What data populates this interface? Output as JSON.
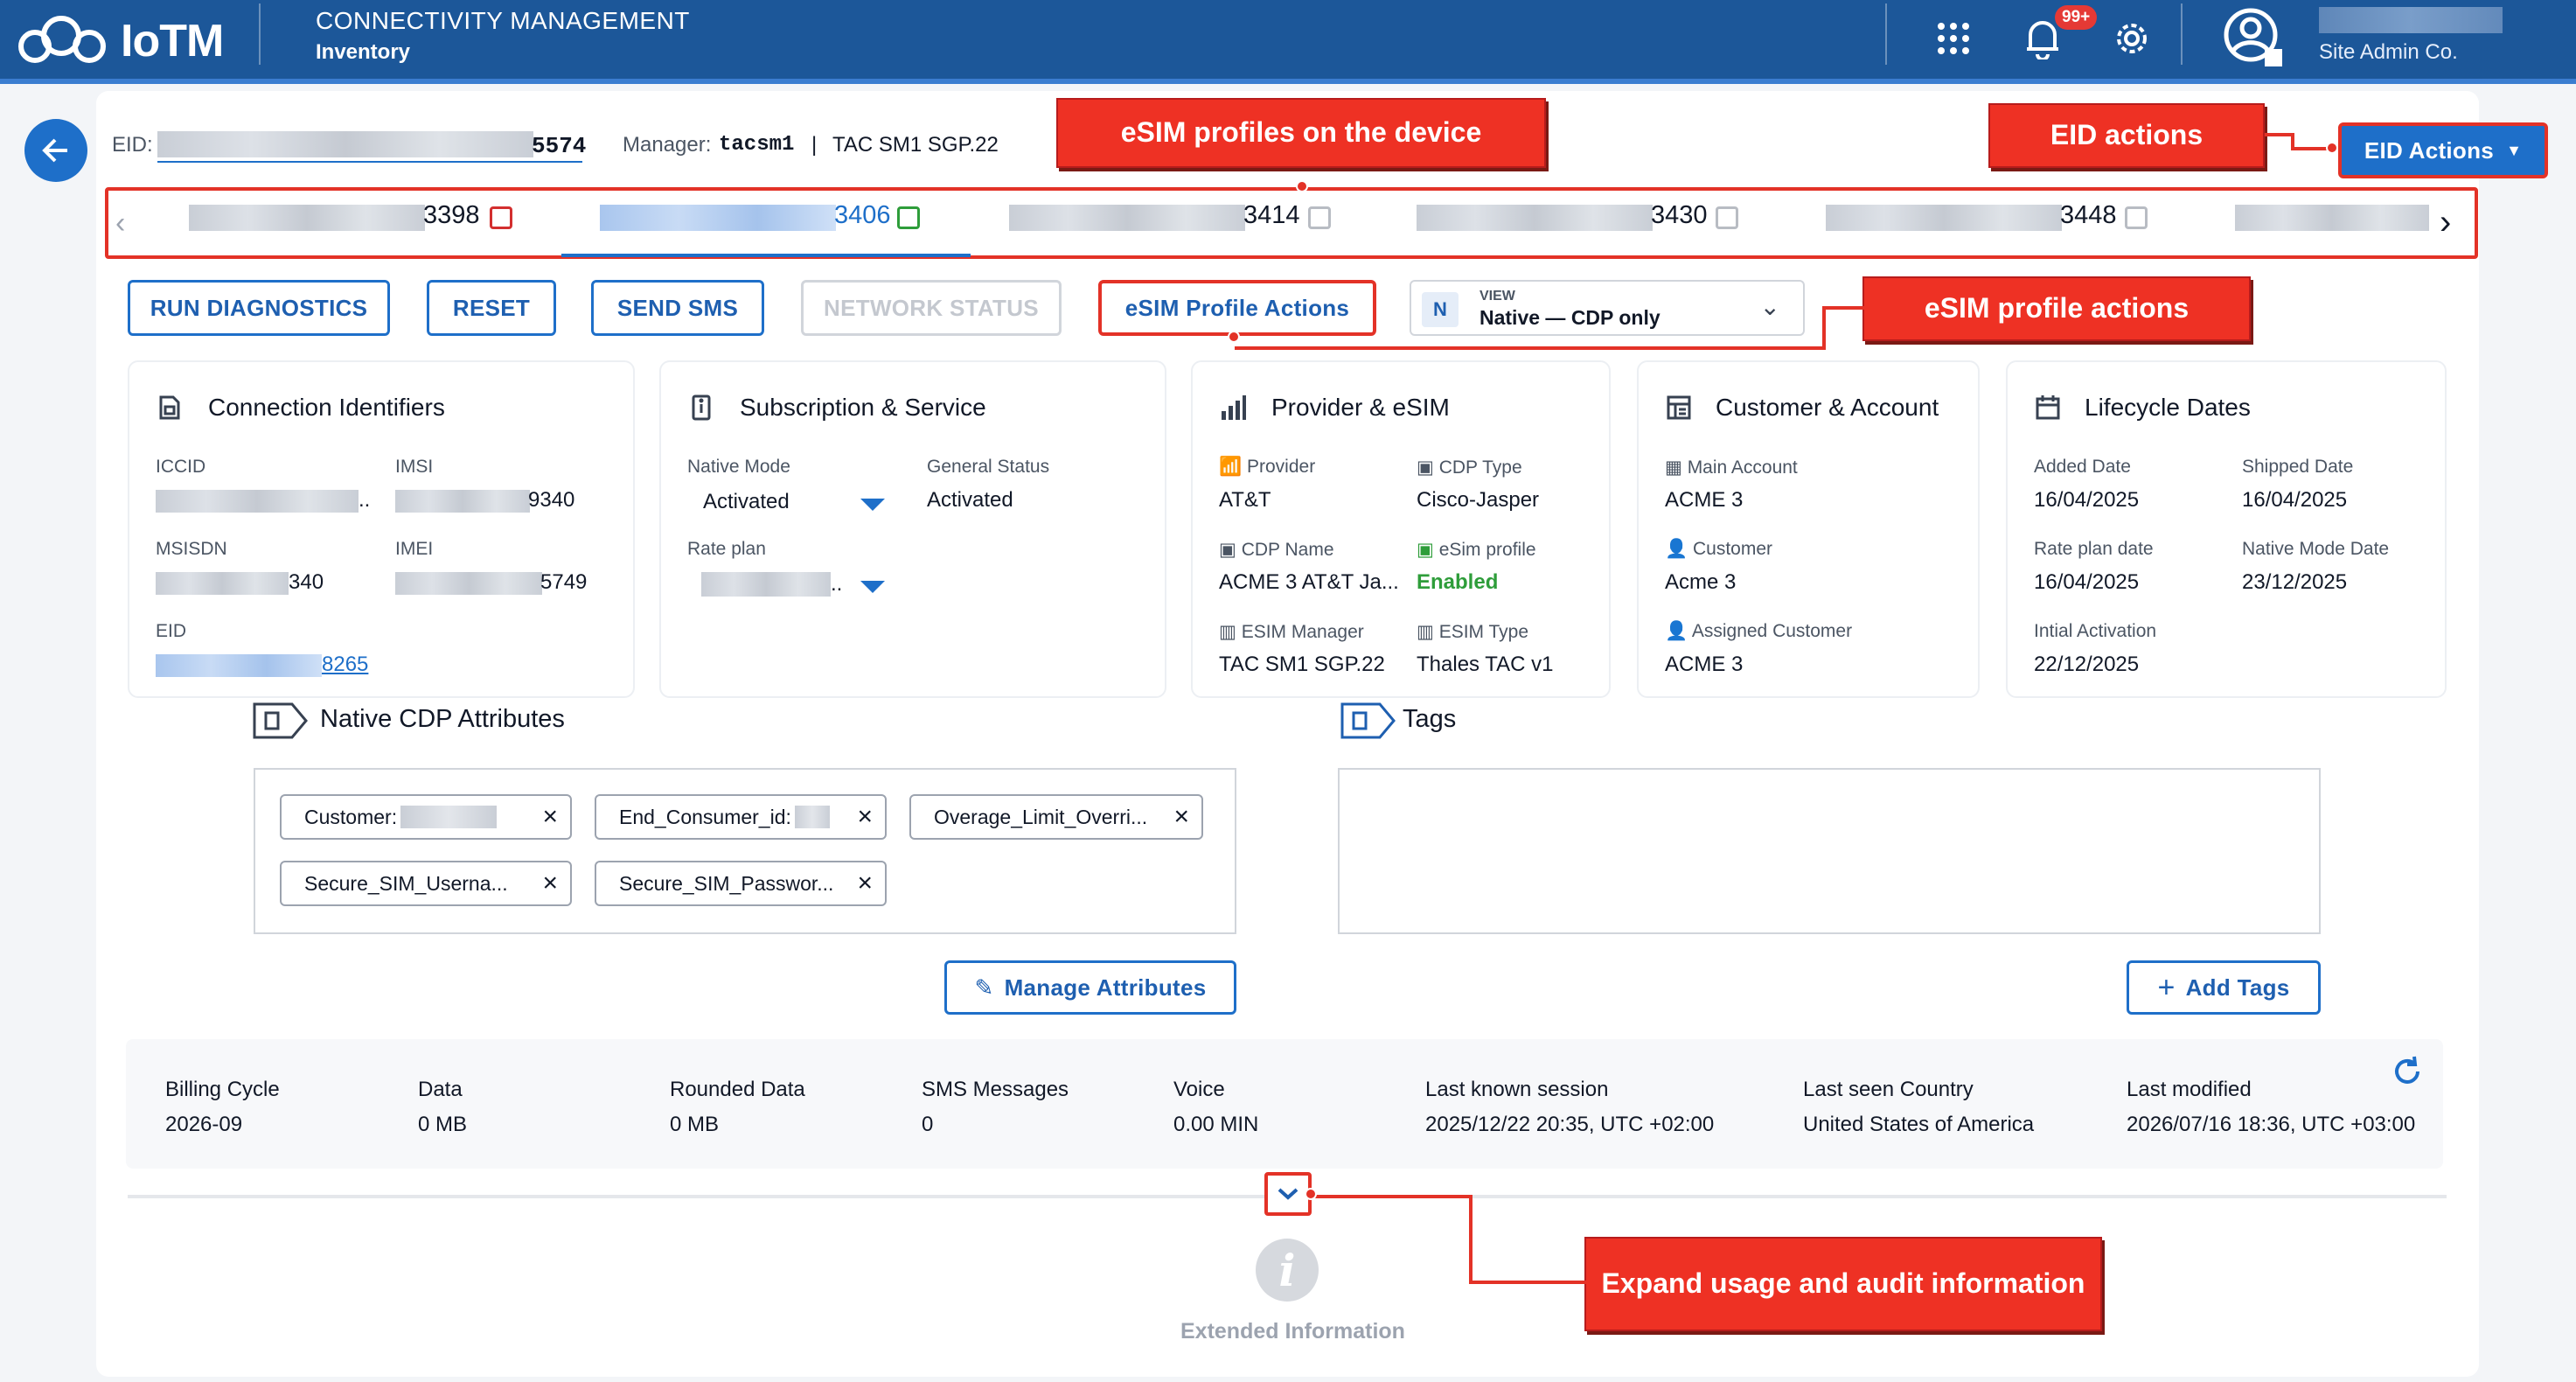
{
  "header": {
    "logo_text": "IoTM",
    "app_title": "CONNECTIVITY MANAGEMENT",
    "app_subtitle": "Inventory",
    "notification_count": "99+",
    "user_role": "Site Admin Co."
  },
  "device": {
    "eid_label": "EID:",
    "eid_suffix": "5574",
    "manager_label": "Manager:",
    "manager_value": "tacsm1",
    "separator": "|",
    "tac_value": "TAC SM1 SGP.22",
    "eid_actions_label": "EID Actions"
  },
  "profiles": [
    {
      "suffix": "3398",
      "status": "red"
    },
    {
      "suffix": "3406",
      "status": "green",
      "active": true
    },
    {
      "suffix": "3414",
      "status": "grey"
    },
    {
      "suffix": "3430",
      "status": "grey"
    },
    {
      "suffix": "3448",
      "status": "grey"
    }
  ],
  "actions": {
    "run_diagnostics": "RUN DIAGNOSTICS",
    "reset": "RESET",
    "send_sms": "SEND SMS",
    "network_status": "NETWORK STATUS",
    "esim_profile_actions": "eSIM Profile Actions",
    "view_badge": "N",
    "view_label": "VIEW",
    "view_value": "Native — CDP only"
  },
  "cards": {
    "connection": {
      "title": "Connection Identifiers",
      "iccid_label": "ICCID",
      "imsi_label": "IMSI",
      "imsi_suffix": "9340",
      "msisdn_label": "MSISDN",
      "msisdn_suffix": "340",
      "imei_label": "IMEI",
      "imei_suffix": "5749",
      "eid_label": "EID",
      "eid_suffix": "8265",
      "ellipsis": ".."
    },
    "subscription": {
      "title": "Subscription & Service",
      "native_mode_label": "Native Mode",
      "native_mode_value": "Activated",
      "general_status_label": "General Status",
      "general_status_value": "Activated",
      "rate_plan_label": "Rate plan",
      "ellipsis": ".."
    },
    "provider": {
      "title": "Provider & eSIM",
      "provider_label": "Provider",
      "provider_value": "AT&T",
      "cdp_type_label": "CDP Type",
      "cdp_type_value": "Cisco-Jasper",
      "cdp_name_label": "CDP Name",
      "cdp_name_value": "ACME 3 AT&T Ja...",
      "esim_profile_label": "eSim profile",
      "esim_profile_value": "Enabled",
      "esim_manager_label": "ESIM Manager",
      "esim_manager_value": "TAC SM1 SGP.22",
      "esim_type_label": "ESIM Type",
      "esim_type_value": "Thales TAC v1"
    },
    "customer": {
      "title": "Customer & Account",
      "main_account_label": "Main Account",
      "main_account_value": "ACME 3",
      "customer_label": "Customer",
      "customer_value": "Acme 3",
      "assigned_customer_label": "Assigned Customer",
      "assigned_customer_value": "ACME 3"
    },
    "lifecycle": {
      "title": "Lifecycle Dates",
      "added_label": "Added Date",
      "added_value": "16/04/2025",
      "shipped_label": "Shipped Date",
      "shipped_value": "16/04/2025",
      "rate_plan_date_label": "Rate plan date",
      "rate_plan_date_value": "16/04/2025",
      "native_mode_date_label": "Native Mode Date",
      "native_mode_date_value": "23/12/2025",
      "initial_activation_label": "Intial Activation",
      "initial_activation_value": "22/12/2025"
    }
  },
  "cdp_attributes": {
    "title": "Native CDP Attributes",
    "chips": [
      "Customer:",
      "End_Consumer_id:",
      "Overage_Limit_Overri...",
      "Secure_SIM_Userna...",
      "Secure_SIM_Passwor..."
    ],
    "manage_button": "Manage Attributes"
  },
  "tags": {
    "title": "Tags",
    "add_button": "Add Tags"
  },
  "usage": {
    "billing_cycle_label": "Billing Cycle",
    "billing_cycle_value": "2026-09",
    "data_label": "Data",
    "data_value": "0 MB",
    "rounded_data_label": "Rounded Data",
    "rounded_data_value": "0 MB",
    "sms_label": "SMS Messages",
    "sms_value": "0",
    "voice_label": "Voice",
    "voice_value": "0.00 MIN",
    "last_session_label": "Last known session",
    "last_session_value": "2025/12/22 20:35, UTC +02:00",
    "last_country_label": "Last seen Country",
    "last_country_value": "United States of America",
    "last_modified_label": "Last modified",
    "last_modified_value": "2026/07/16 18:36, UTC +03:00"
  },
  "extended": {
    "label": "Extended Information"
  },
  "callouts": {
    "profiles": "eSIM profiles on the device",
    "eid_actions": "EID actions",
    "profile_actions": "eSIM profile actions",
    "expand": "Expand usage and audit information"
  },
  "colors": {
    "header_bg": "#1c5799",
    "accent_blue": "#1e6fc9",
    "callout_red": "#ee3124",
    "enabled_green": "#2e9d3a"
  }
}
